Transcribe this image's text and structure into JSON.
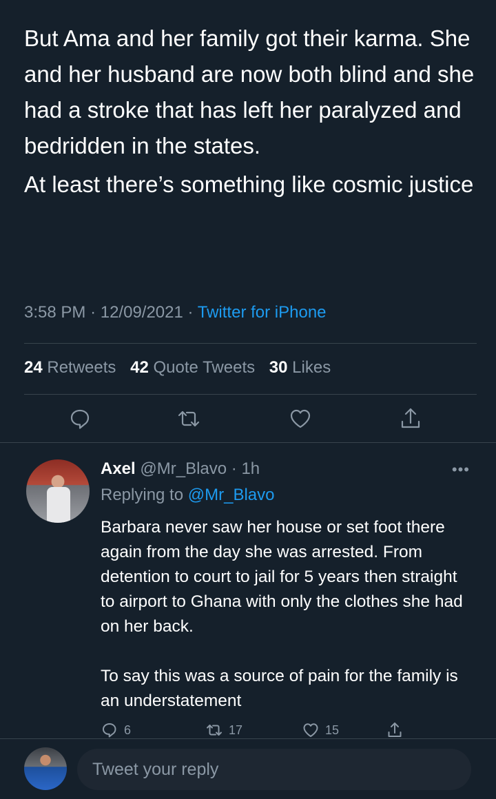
{
  "tweet": {
    "paragraphs": [
      "But Ama and her family got their karma. She and her husband are now both blind and she had a stroke that has left her paralyzed and bedridden in the states.",
      "At least there’s something like cosmic justice"
    ],
    "time": "3:58 PM",
    "date": "12/09/2021",
    "source": "Twitter for iPhone",
    "stats": {
      "retweets": "24",
      "retweets_label": "Retweets",
      "quotes": "42",
      "quotes_label": "Quote Tweets",
      "likes": "30",
      "likes_label": "Likes"
    },
    "action_icons": [
      "reply-icon",
      "retweet-icon",
      "like-icon",
      "share-icon"
    ]
  },
  "reply": {
    "name": "Axel",
    "handle": "@Mr_Blavo",
    "time": "1h",
    "more": "•••",
    "replying_prefix": "Replying to",
    "replying_handle": "@Mr_Blavo",
    "paragraphs": [
      "Barbara never saw her house or set foot there again from the day she was arrested. From detention to court to jail for 5 years then straight to airport to Ghana with only the clothes she had on her back.",
      "To say this was a source of pain for the family is an understatement"
    ],
    "replies": "6",
    "retweets": "17",
    "likes": "15"
  },
  "composer": {
    "placeholder": "Tweet your reply"
  },
  "colors": {
    "background": "#15202b",
    "muted": "#8b98a5",
    "accent": "#1d9bf0",
    "divider": "#38444d"
  }
}
